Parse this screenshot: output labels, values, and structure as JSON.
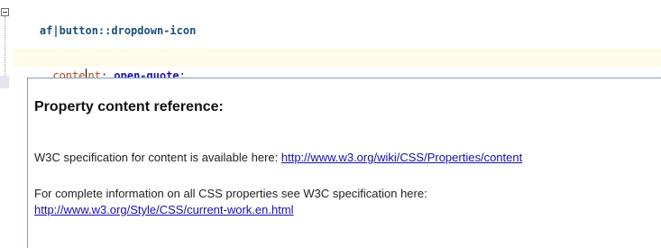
{
  "code": {
    "selector": "af|button::dropdown-icon",
    "open_brace": "{",
    "property_before_caret": "conte",
    "property_after_caret": "nt",
    "colon": ":",
    "value": "open-quote",
    "semicolon": ";"
  },
  "popup": {
    "title": "Property content reference:",
    "spec_text": "W3C specification for content is available here:",
    "spec_link": "http://www.w3.org/wiki/CSS/Properties/content",
    "all_props_text": "For complete information on all CSS properties see W3C specification here:",
    "all_props_link": "http://www.w3.org/Style/CSS/current-work.en.html"
  },
  "colors": {
    "current_line_highlight": "#fffbe8",
    "link": "#1a0dab",
    "popup_border": "#7f9db9"
  }
}
